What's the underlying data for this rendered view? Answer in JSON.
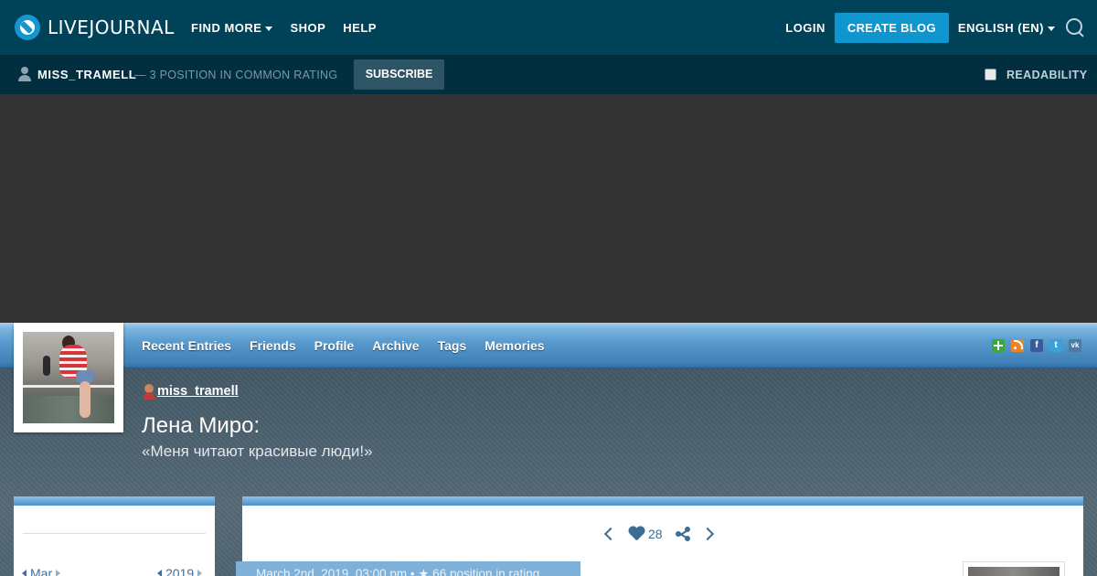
{
  "topbar": {
    "logo_text": "LIVEJOURNAL",
    "nav": [
      {
        "label": "FIND MORE",
        "has_caret": true
      },
      {
        "label": "SHOP",
        "has_caret": false
      },
      {
        "label": "HELP",
        "has_caret": false
      }
    ],
    "login": "LOGIN",
    "create_blog": "CREATE BLOG",
    "language": "ENGLISH (EN)"
  },
  "subbar": {
    "username": "MISS_TRAMELL",
    "rating_text": "— 3 POSITION IN COMMON RATING",
    "subscribe": "SUBSCRIBE",
    "readability": "READABILITY"
  },
  "journal": {
    "menu": [
      "Recent Entries",
      "Friends",
      "Profile",
      "Archive",
      "Tags",
      "Memories"
    ],
    "share_icons": [
      "add-icon",
      "rss-icon",
      "facebook-icon",
      "twitter-icon",
      "vk-icon"
    ],
    "user_tag": "miss_tramell",
    "title": "Лена Миро:",
    "subtitle": "«Меня читают красивые люди!»"
  },
  "sidebar": {
    "calendar_month": "Mar",
    "calendar_year": "2019"
  },
  "entry": {
    "like_count": "28",
    "meta": "March 2nd, 2019, 03:00 pm • ★ 66 position in rating"
  },
  "colors": {
    "topbar_bg": "#004359",
    "subbar_bg": "#012f40",
    "accent": "#0f96cf",
    "menu_blue": "#4c8fc9"
  }
}
